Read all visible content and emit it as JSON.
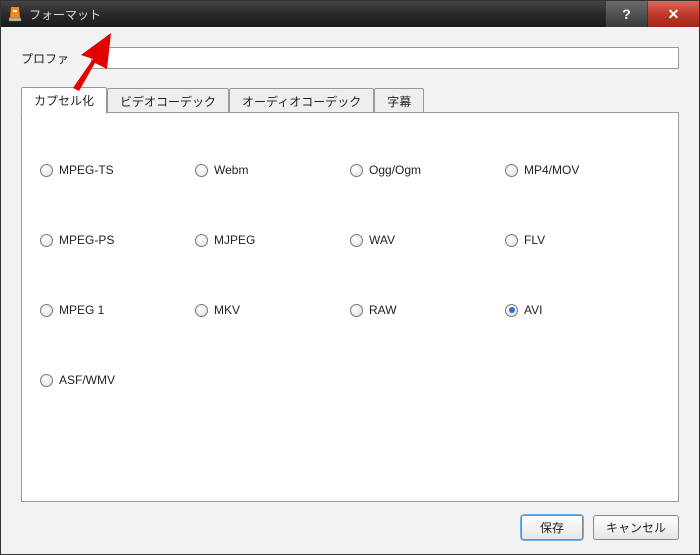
{
  "window": {
    "title": "フォーマット",
    "help_label": "?",
    "close_label": "✕"
  },
  "profile": {
    "label": "プロファ",
    "value": ""
  },
  "tabs": [
    {
      "label": "カプセル化",
      "active": true
    },
    {
      "label": "ビデオコーデック",
      "active": false
    },
    {
      "label": "オーディオコーデック",
      "active": false
    },
    {
      "label": "字幕",
      "active": false
    }
  ],
  "formats": [
    {
      "label": "MPEG-TS",
      "selected": false
    },
    {
      "label": "Webm",
      "selected": false
    },
    {
      "label": "Ogg/Ogm",
      "selected": false
    },
    {
      "label": "MP4/MOV",
      "selected": false
    },
    {
      "label": "MPEG-PS",
      "selected": false
    },
    {
      "label": "MJPEG",
      "selected": false
    },
    {
      "label": "WAV",
      "selected": false
    },
    {
      "label": "FLV",
      "selected": false
    },
    {
      "label": "MPEG 1",
      "selected": false
    },
    {
      "label": "MKV",
      "selected": false
    },
    {
      "label": "RAW",
      "selected": false
    },
    {
      "label": "AVI",
      "selected": true
    },
    {
      "label": "ASF/WMV",
      "selected": false
    }
  ],
  "buttons": {
    "save": "保存",
    "cancel": "キャンセル"
  },
  "annotation": {
    "arrow_color": "#e20000"
  }
}
